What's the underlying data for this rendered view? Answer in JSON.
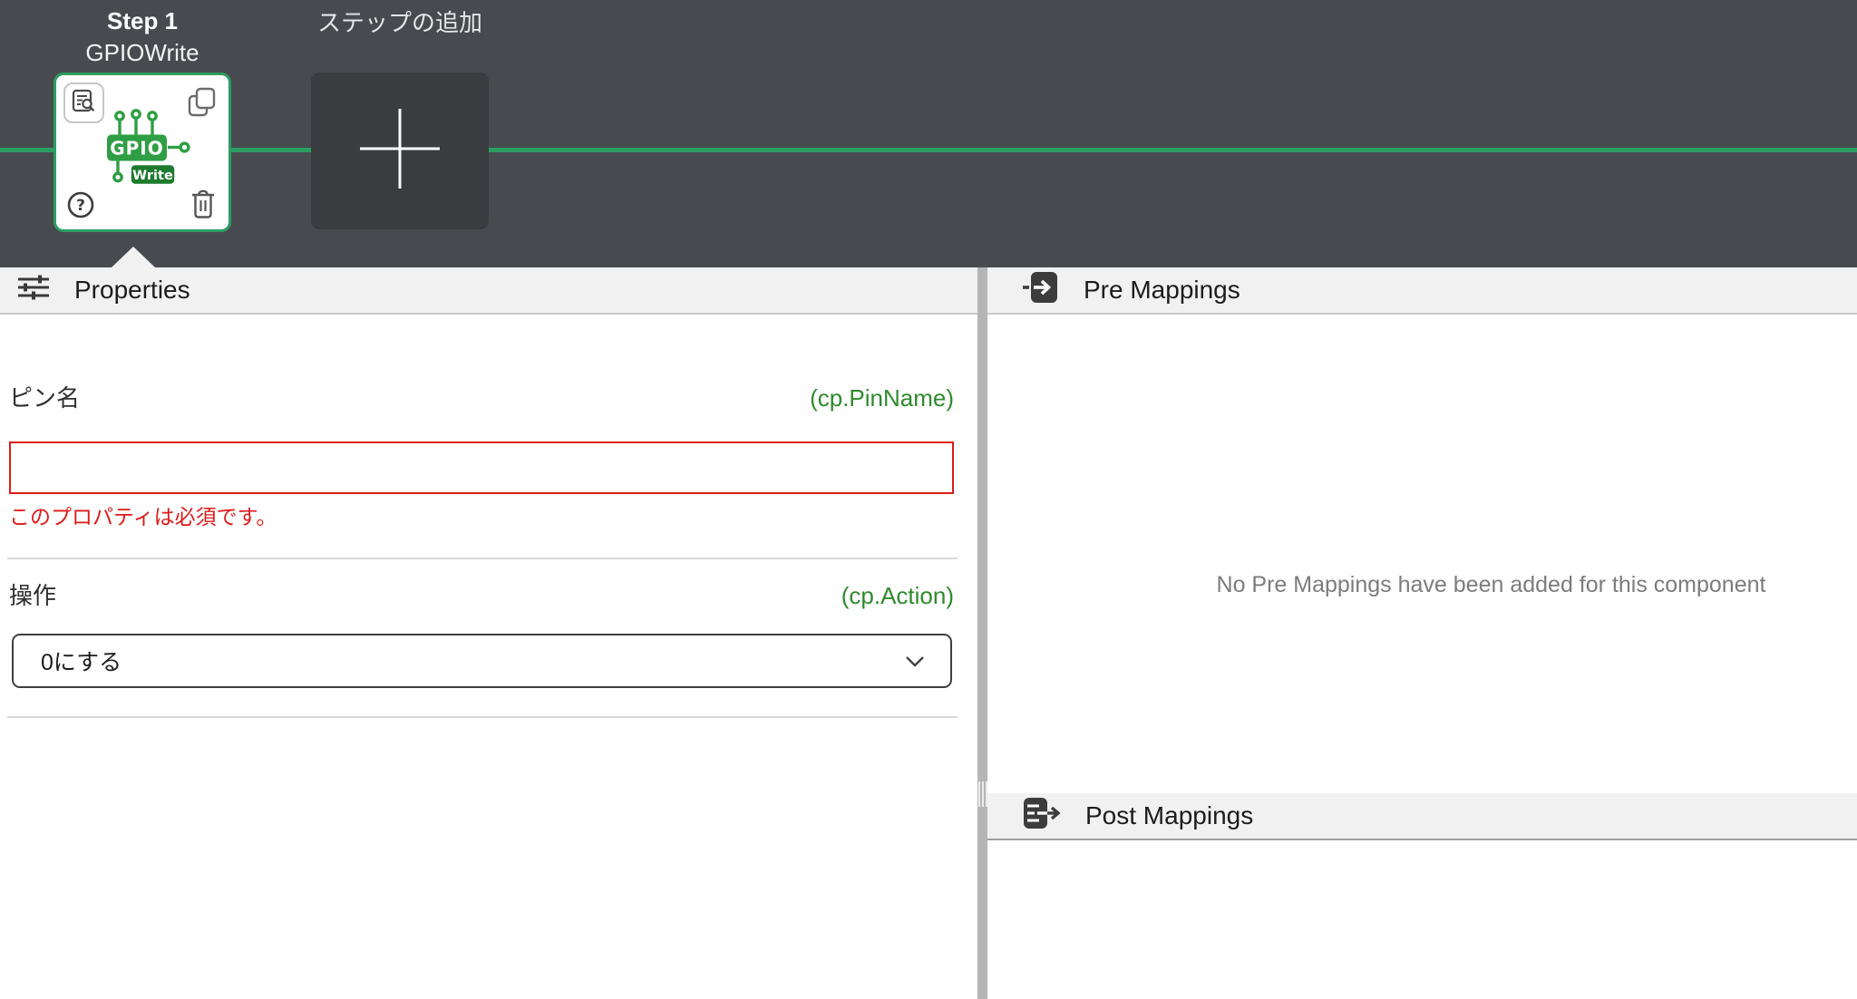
{
  "colors": {
    "topbar_bg": "#474b4f",
    "tile_bg": "#3a3d40",
    "accent_green": "#2c9e62",
    "code_green": "#2e8b2c",
    "error_red": "#dd1b1b",
    "header_bg": "#f1f1f1",
    "splitter": "#b5b5b5"
  },
  "workflow": {
    "step1": {
      "title": "Step 1",
      "subtitle": "GPIOWrite",
      "icon_text": "GPIO",
      "icon_badge": "Write"
    },
    "add_step": {
      "label": "ステップの追加"
    }
  },
  "properties": {
    "header_label": "Properties",
    "fields": [
      {
        "label": "ピン名",
        "binding": "(cp.PinName)",
        "value": "",
        "error": "このプロパティは必須です。",
        "type": "text"
      },
      {
        "label": "操作",
        "binding": "(cp.Action)",
        "value": "0にする",
        "type": "select"
      }
    ]
  },
  "pre_mappings": {
    "header_label": "Pre Mappings",
    "empty_text": "No Pre Mappings have been added for this component"
  },
  "post_mappings": {
    "header_label": "Post Mappings"
  },
  "icons": {
    "properties_header": "sliders-icon",
    "pre_mappings_header": "import-arrow-icon",
    "post_mappings_header": "export-arrow-icon",
    "card_top_left": "document-search-icon",
    "card_top_right": "copy-icon",
    "card_bottom_left": "help-circle-icon",
    "card_bottom_right": "trash-icon",
    "add_tile": "plus-icon",
    "select": "chevron-down-icon"
  }
}
